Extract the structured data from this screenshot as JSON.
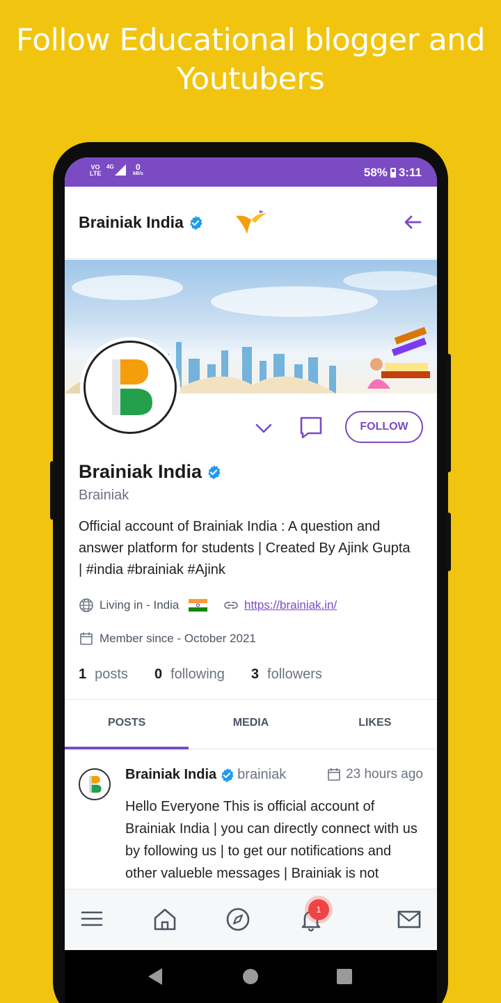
{
  "promo": {
    "line1": "Follow Educational blogger and",
    "line2": "Youtubers"
  },
  "statusbar": {
    "battery": "58%",
    "time": "3:11",
    "data_speed": "0",
    "data_unit": "kB/s",
    "network": "4G",
    "volte": "VO LTE"
  },
  "topbar": {
    "title": "Brainiak India"
  },
  "profile": {
    "name": "Brainiak India",
    "username": "Brainiak",
    "follow_label": "FOLLOW",
    "bio": "Official account of Brainiak India : A question and answer platform for students | Created By Ajink Gupta | #india #brainiak #Ajink",
    "location": "Living in - India",
    "website": "https://brainiak.in/",
    "member_since": "Member since - October 2021",
    "stats": {
      "posts_count": "1",
      "posts_label": "posts",
      "following_count": "0",
      "following_label": "following",
      "followers_count": "3",
      "followers_label": "followers"
    }
  },
  "tabs": [
    "POSTS",
    "MEDIA",
    "LIKES"
  ],
  "post": {
    "author": "Brainiak India",
    "handle": "brainiak",
    "time": "23 hours ago",
    "body": "Hello Everyone This is official account of Brainiak India | you can directly connect with us by following us | to get our notifications and other valueble messages | Brainiak is not"
  },
  "bottomnav": {
    "notification_count": "1"
  },
  "colors": {
    "background": "#f1c40f",
    "accent": "#7b4bc4",
    "verified": "#1d9bf0",
    "badge": "#ef4444"
  },
  "icons": [
    "menu-icon",
    "home-icon",
    "compass-icon",
    "bell-icon",
    "mail-icon",
    "back-arrow-icon",
    "chevron-down-icon",
    "chat-icon",
    "globe-icon",
    "link-icon",
    "calendar-icon",
    "verified-icon"
  ]
}
